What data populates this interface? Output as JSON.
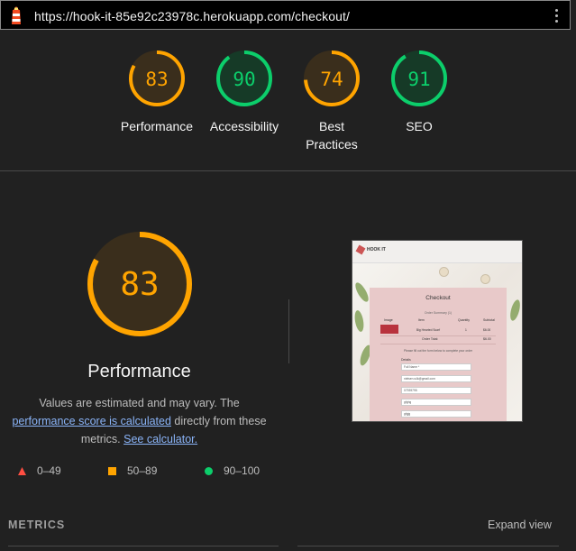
{
  "browser": {
    "url": "https://hook-it-85e92c23978c.herokuapp.com/checkout/",
    "logo_icon": "lighthouse-icon",
    "menu_icon": "kebab-menu-icon"
  },
  "gauges": [
    {
      "label": "Performance",
      "value": 83,
      "status": "average"
    },
    {
      "label": "Accessibility",
      "value": 90,
      "status": "pass"
    },
    {
      "label": "Best\nPractices",
      "value": 74,
      "status": "average"
    },
    {
      "label": "SEO",
      "value": 91,
      "status": "pass"
    }
  ],
  "colors": {
    "average": "#ffa400",
    "average_bg": "#3a2e1c",
    "pass": "#0cce6b",
    "pass_bg": "#163a27",
    "fail": "#ff4e42",
    "link": "#8ab4f8"
  },
  "main": {
    "score": 83,
    "title": "Performance",
    "desc_prefix": "Values are estimated and may vary. The ",
    "desc_link1": "performance score is calculated",
    "desc_mid": " directly from these metrics. ",
    "desc_link2": "See calculator."
  },
  "legend": [
    {
      "range": "0–49",
      "shape": "triangle",
      "color": "#ff4e42"
    },
    {
      "range": "50–89",
      "shape": "square",
      "color": "#ffa400"
    },
    {
      "range": "90–100",
      "shape": "circle",
      "color": "#0cce6b"
    }
  ],
  "screenshot": {
    "brand": "HOOK IT",
    "heading": "Checkout",
    "summary": "Order Summary (1)",
    "cols": [
      "Image",
      "Item",
      "Quantity",
      "Subtotal"
    ],
    "item": "Big Hearted Scarf",
    "qty": "1",
    "subtotal": "$6.00",
    "total_label": "Order Total:",
    "total": "$6.00",
    "note": "Please fill out the form below to complete your order",
    "details_label": "Details",
    "fields": [
      "Full Name *",
      "nielsen.s4k@gmail.com",
      "07939795",
      "gfghg",
      "gfgjg"
    ]
  },
  "footer": {
    "metrics_label": "METRICS",
    "expand_label": "Expand view"
  }
}
